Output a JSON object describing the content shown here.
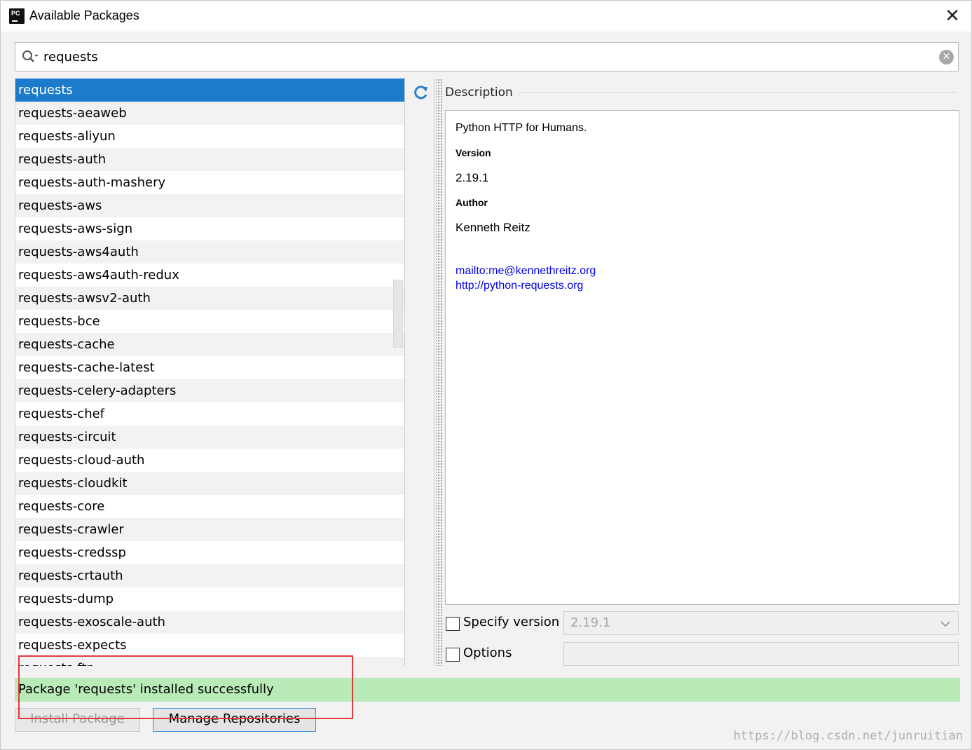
{
  "window": {
    "title": "Available Packages",
    "app_icon_text": "PC"
  },
  "search": {
    "value": "requests"
  },
  "packages": [
    "requests",
    "requests-aeaweb",
    "requests-aliyun",
    "requests-auth",
    "requests-auth-mashery",
    "requests-aws",
    "requests-aws-sign",
    "requests-aws4auth",
    "requests-aws4auth-redux",
    "requests-awsv2-auth",
    "requests-bce",
    "requests-cache",
    "requests-cache-latest",
    "requests-celery-adapters",
    "requests-chef",
    "requests-circuit",
    "requests-cloud-auth",
    "requests-cloudkit",
    "requests-core",
    "requests-crawler",
    "requests-credssp",
    "requests-crtauth",
    "requests-dump",
    "requests-exoscale-auth",
    "requests-expects",
    "requests-ftp"
  ],
  "selected_index": 0,
  "description": {
    "header": "Description",
    "summary": "Python HTTP for Humans.",
    "version_label": "Version",
    "version": "2.19.1",
    "author_label": "Author",
    "author": "Kenneth Reitz",
    "email_link": "mailto:me@kennethreitz.org",
    "home_link": "http://python-requests.org"
  },
  "options": {
    "specify_version_label": "Specify version",
    "specify_version_checked": false,
    "version_value": "2.19.1",
    "options_label": "Options",
    "options_checked": false,
    "options_value": ""
  },
  "status": {
    "message": "Package 'requests' installed successfully",
    "color": "#b9ebb8"
  },
  "buttons": {
    "install": "Install Package",
    "manage": "Manage Repositories"
  },
  "watermark": "https://blog.csdn.net/junruitian",
  "colors": {
    "selection": "#1d7bcb",
    "link": "#0000ee",
    "highlight_box": "#e23a3a"
  }
}
